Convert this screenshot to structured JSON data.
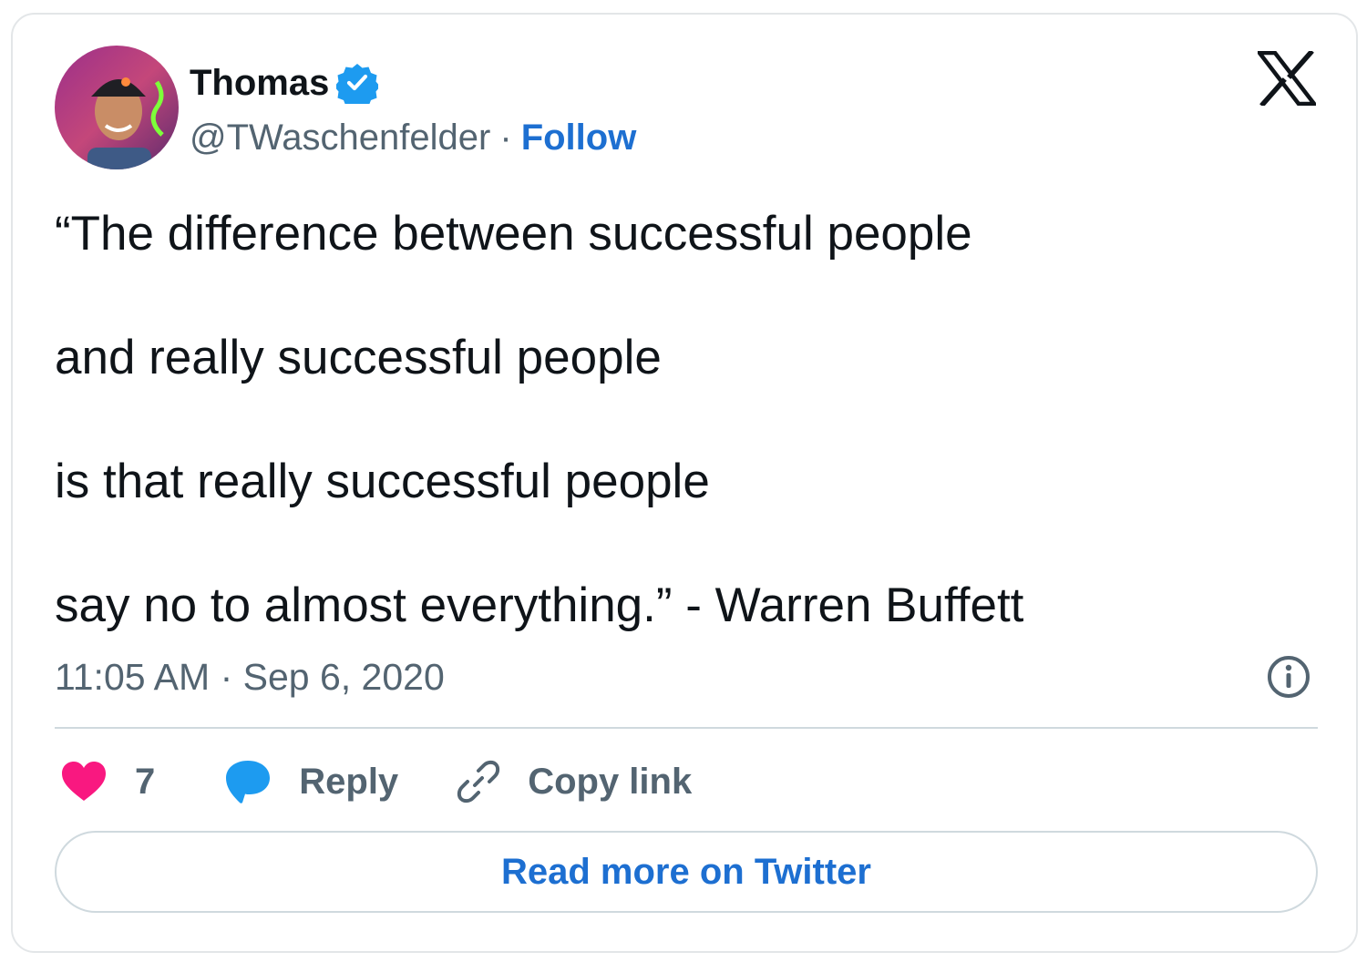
{
  "author": {
    "name": "Thomas",
    "handle": "@TWaschenfelder",
    "separator": "·",
    "follow_label": "Follow",
    "verified": true
  },
  "brand": {
    "logo_icon": "x-logo-icon"
  },
  "tweet": {
    "lines": [
      "“The difference between successful people",
      "and really successful people",
      "is that really successful people",
      "say no to almost everything.” - Warren Buffett"
    ],
    "timestamp": "11:05 AM · Sep 6, 2020"
  },
  "actions": {
    "like_count": "7",
    "reply_label": "Reply",
    "copy_link_label": "Copy link"
  },
  "footer": {
    "read_more_label": "Read more on Twitter"
  },
  "colors": {
    "accent": "#1d6fd1",
    "verified": "#1d9bf0",
    "like": "#f91880",
    "reply": "#1d9bf0",
    "text_primary": "#0f1419",
    "text_secondary": "#536471",
    "border": "#cfd9de"
  }
}
